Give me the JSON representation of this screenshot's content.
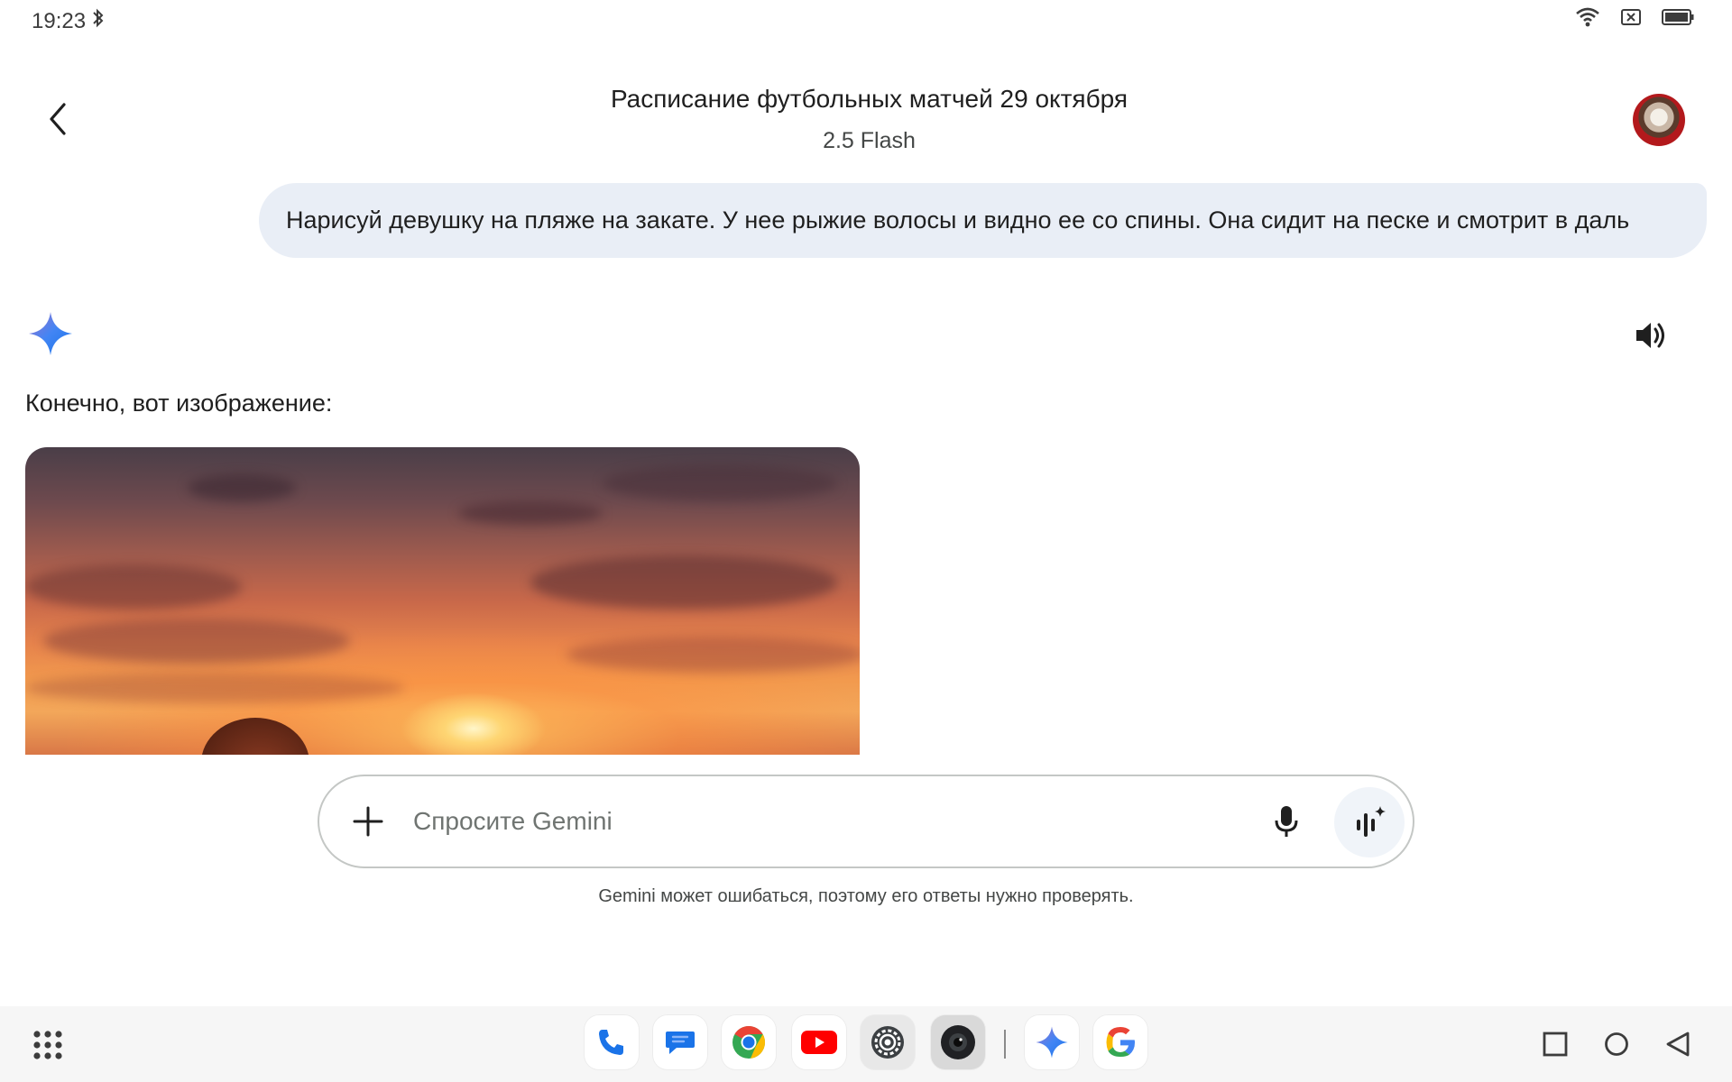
{
  "status_bar": {
    "time": "19:23",
    "icons": [
      "bluetooth-icon",
      "wifi-icon",
      "no-sim-icon",
      "battery-icon"
    ]
  },
  "header": {
    "title": "Расписание футбольных матчей 29 октября",
    "model": "2.5 Flash"
  },
  "conversation": {
    "user_message": "Нарисуй девушку на пляже на закате. У нее рыжие волосы и видно ее со спины. Она сидит на песке и смотрит в даль",
    "response_text": "Конечно, вот изображение:"
  },
  "input": {
    "placeholder": "Спросите Gemini",
    "value": ""
  },
  "disclaimer": "Gemini может ошибаться, поэтому его ответы нужно проверять.",
  "dock": {
    "apps": [
      "phone",
      "messages",
      "chrome",
      "youtube",
      "settings",
      "camera",
      "gemini",
      "google"
    ]
  },
  "colors": {
    "bubble": "#e9eef6",
    "gemini_blue": "#4285f4",
    "text": "#1f1f1f"
  }
}
